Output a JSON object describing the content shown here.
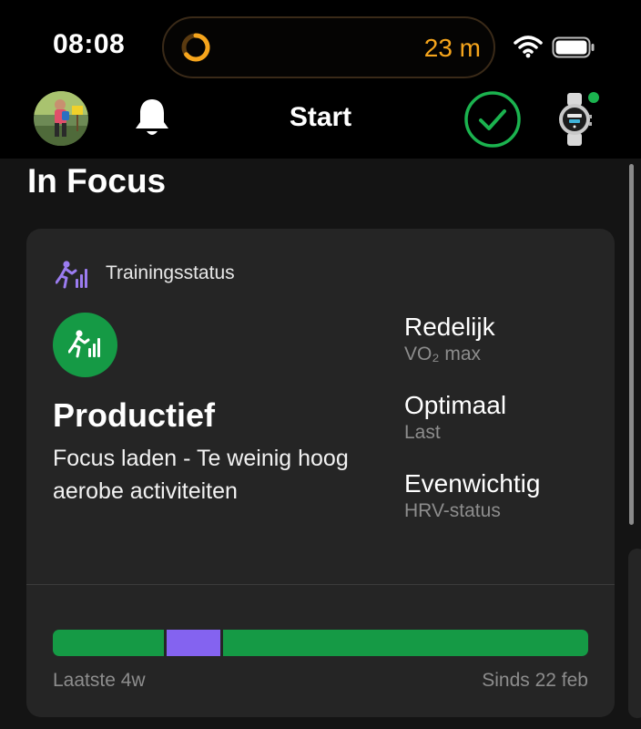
{
  "status_bar": {
    "time": "08:08",
    "activity_value": "23 m",
    "activity_color": "#f6a51c",
    "icons": [
      "activity-ring-icon",
      "wifi-icon",
      "battery-icon"
    ]
  },
  "nav": {
    "title": "Start",
    "icons": [
      "avatar",
      "bell-icon",
      "sync-check-icon",
      "watch-icon"
    ],
    "sync_color": "#1bb34f",
    "watch_status_color": "#1bb34f"
  },
  "section": {
    "title": "In Focus"
  },
  "card": {
    "header_label": "Trainingsstatus",
    "header_icon_color": "#9b7cf0",
    "status_icon_color": "#159a45",
    "status_title": "Productief",
    "status_description": "Focus laden - Te weinig hoog aerobe activiteiten",
    "metrics": [
      {
        "value": "Redelijk",
        "label": "VO₂ max"
      },
      {
        "value": "Optimaal",
        "label": "Last"
      },
      {
        "value": "Evenwichtig",
        "label": "HRV-status"
      }
    ],
    "timeline": {
      "start_label": "Laatste 4w",
      "end_label": "Sinds 22 feb",
      "segments": [
        {
          "status": "productief",
          "color": "#159a45",
          "fraction": 0.21
        },
        {
          "status": "other",
          "color": "#8463f0",
          "fraction": 0.105
        },
        {
          "status": "productief",
          "color": "#159a45",
          "fraction": 0.685
        }
      ]
    }
  }
}
